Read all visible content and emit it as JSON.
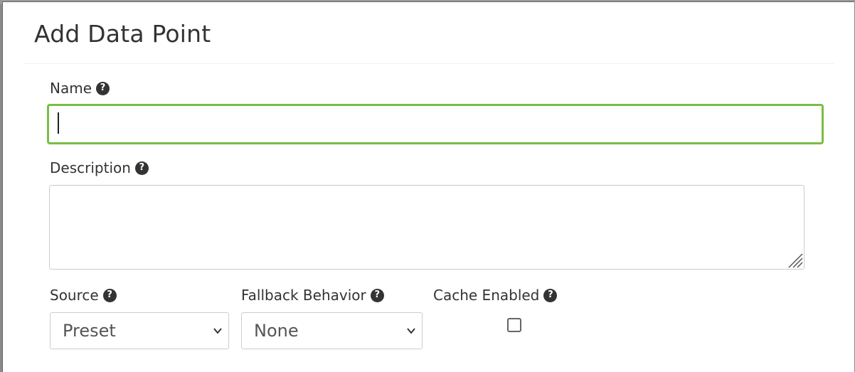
{
  "modal": {
    "title": "Add Data Point"
  },
  "form": {
    "name": {
      "label": "Name",
      "value": ""
    },
    "description": {
      "label": "Description",
      "value": ""
    },
    "source": {
      "label": "Source",
      "selected": "Preset"
    },
    "fallback": {
      "label": "Fallback Behavior",
      "selected": "None"
    },
    "cache": {
      "label": "Cache Enabled",
      "checked": false
    }
  },
  "icons": {
    "help": "question-circle-icon",
    "select_arrow": "chevron-down-icon"
  },
  "colors": {
    "focus_border": "#79bd46",
    "text": "#333333",
    "border": "#cccccc"
  }
}
